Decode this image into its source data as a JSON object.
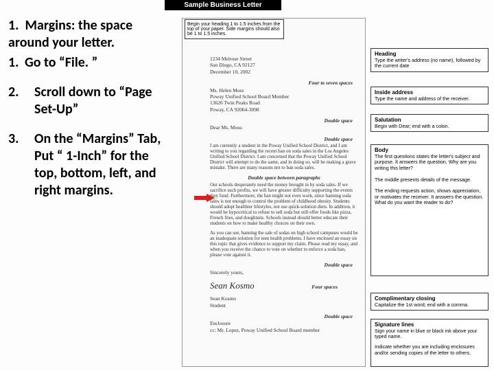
{
  "title_bar": "Sample Business Letter",
  "instructions": {
    "intro_num": "1.",
    "intro_text": "Margins: the space around your letter.",
    "step1_num": "1.",
    "step1_text": "Go to “File. ”",
    "step2_num": "2.",
    "step2_text": "Scroll down to “Page Set-Up”",
    "step3_num": "3.",
    "step3_text": "On the “Margins” Tab, Put “ 1-Inch” for the top, bottom, left, and right margins."
  },
  "margin_note": "Begin your heading 1 to 1.5 inches from the top of your paper. Side margins should also be 1 to 1.5 inches.",
  "letter": {
    "addr1": "1234 Melrose Street",
    "addr2": "San Diego, CA 92127",
    "addr3": "December 10, 2002",
    "sp_four7": "Four to seven spaces",
    "ia1": "Ms. Helen Moss",
    "ia2": "Poway Unified School Board Member",
    "ia3": "13626 Twin Peaks Road",
    "ia4": "Poway, CA 92064-3098",
    "sp_double": "Double space",
    "salut": "Dear Ms. Moss:",
    "p1": "I am currently a student in the Poway Unified School District, and I am writing to you regarding the recent ban on soda sales in the Los Angeles Unified School District. I am concerned that the Poway Unified School District will attempt to do the same, and in doing so, will be making a grave mistake. There are many reasons not to ban soda sales.",
    "sp_para": "Double space between paragraphs",
    "p2": "Our schools desperately need the money brought in by soda sales. If we sacrifice such profits, we will have greater difficulty supporting the events they fund. Furthermore, the ban might not even work, since banning soda sales is not enough to control the problem of childhood obesity. Students should adopt healthier lifestyles, not use quick-solution diets. In addition, it would be hypocritical to refuse to sell soda but still offer foods like pizza, French fries, and doughnuts. Schools instead should better educate their students on how to make healthy choices on their own.",
    "p3": "As you can see, banning the sale of sodas on high school campuses would be an inadequate solution for teen health problems. I have enclosed an essay on this topic that gives evidence to support my claim. Please read my essay, and when you receive the chance to vote on whether to enforce a soda ban, please vote against it.",
    "close": "Sincerely yours,",
    "sp_four": "Four spaces",
    "sig": "Sean Kosmo",
    "typed1": "Sean Kosmo",
    "typed2": "Student",
    "enc": "Enclosure",
    "cc": "cc: Mr. Lopez, Poway Unified School Board member"
  },
  "annotations": {
    "heading_label": "Heading",
    "heading_text": "Type the writer's address (no name), followed by the current date",
    "inside_label": "Inside address",
    "inside_text": "Type the name and address of the receiver.",
    "salut_label": "Salutation",
    "salut_text": "Begin with Dear; end with a colon.",
    "body_label": "Body",
    "body_p1": "The first questions states the letter's subject and purpose. It answers the question. Why are you writing this letter?",
    "body_p2": "The middle presents details of the message.",
    "body_p3": "The ending requests action, shows appreciation, or motivates the receiver. It answers the question. What do you want the reader to do?",
    "close_label": "Complimentary closing",
    "close_text": "Capitalize the 1st word; end with a comma.",
    "sig_label": "Signature lines",
    "sig_p1": "Sign your name in blue or black ink above your typed name.",
    "sig_p2": "Indicate whether you are including enclosures and/or sending copies of the letter to others."
  }
}
